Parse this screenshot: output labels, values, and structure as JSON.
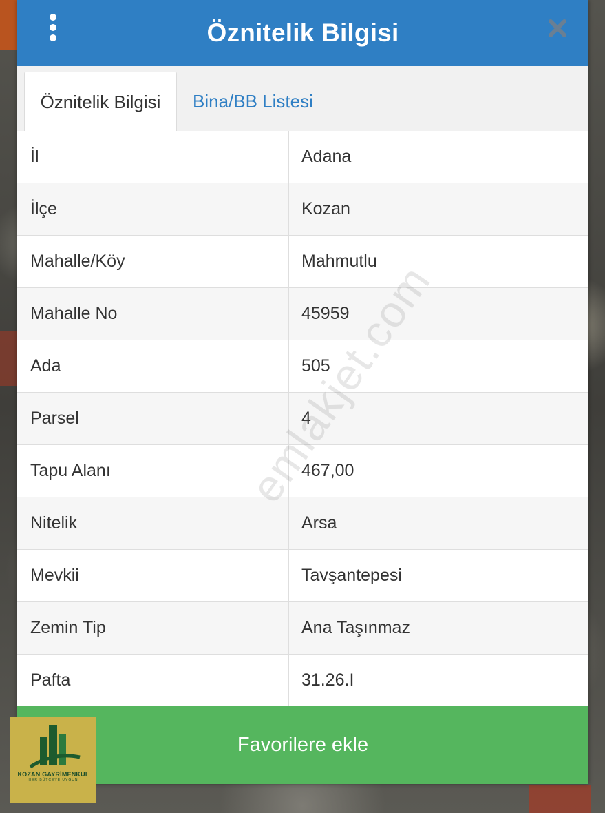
{
  "header": {
    "title": "Öznitelik Bilgisi",
    "menu_icon": "more-vertical-icon",
    "close_icon": "close-icon"
  },
  "tabs": [
    {
      "label": "Öznitelik Bilgisi",
      "active": true
    },
    {
      "label": "Bina/BB Listesi",
      "active": false
    }
  ],
  "rows": [
    {
      "key": "İl",
      "value": "Adana"
    },
    {
      "key": "İlçe",
      "value": "Kozan"
    },
    {
      "key": "Mahalle/Köy",
      "value": "Mahmutlu"
    },
    {
      "key": "Mahalle No",
      "value": "45959"
    },
    {
      "key": "Ada",
      "value": "505"
    },
    {
      "key": "Parsel",
      "value": "4"
    },
    {
      "key": "Tapu Alanı",
      "value": "467,00"
    },
    {
      "key": "Nitelik",
      "value": "Arsa"
    },
    {
      "key": "Mevkii",
      "value": "Tavşantepesi"
    },
    {
      "key": "Zemin Tip",
      "value": "Ana Taşınmaz"
    },
    {
      "key": "Pafta",
      "value": "31.26.I"
    }
  ],
  "watermark": "emlakjet.com",
  "favorites_button": {
    "label": "Favorilere ekle"
  },
  "logo": {
    "name": "KOZAN GAYRİMENKUL",
    "slogan": "HER BÜTÇEYE UYGUN"
  },
  "colors": {
    "header": "#2f7fc4",
    "tab_link": "#2f7fc4",
    "favorites_button": "#55b65e",
    "logo_bg": "#c9b24a"
  }
}
